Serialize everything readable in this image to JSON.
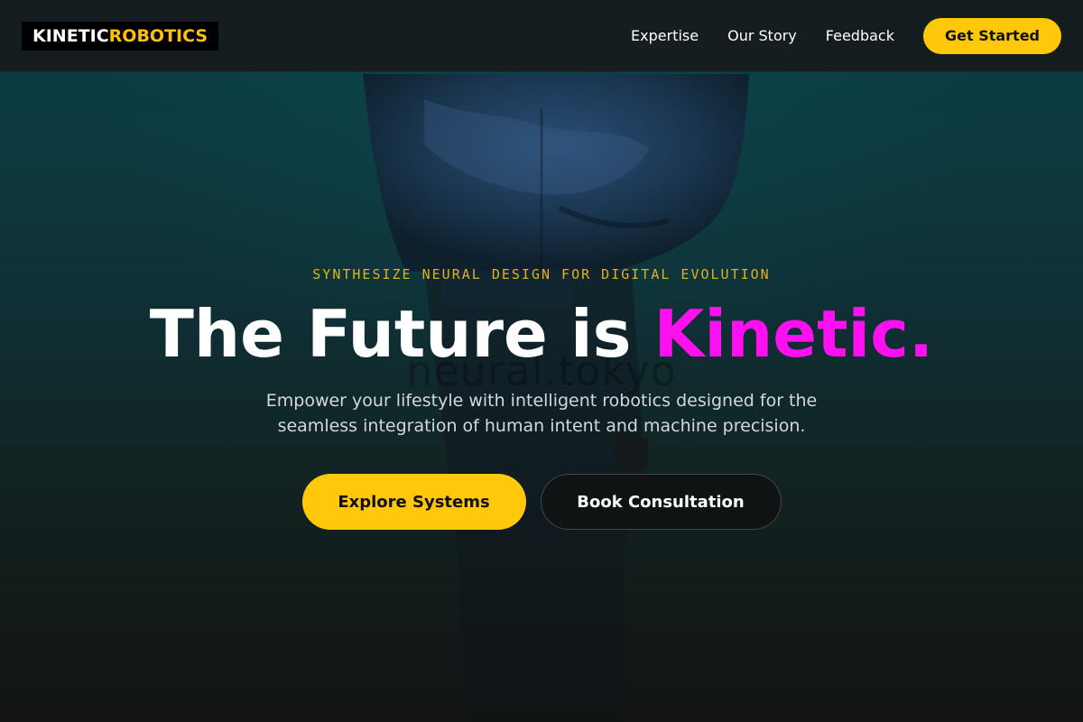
{
  "header": {
    "logo": {
      "part1": "KINETIC",
      "part2": "ROBOTICS"
    },
    "nav": [
      {
        "label": "Expertise"
      },
      {
        "label": "Our Story"
      },
      {
        "label": "Feedback"
      }
    ],
    "cta_label": "Get Started"
  },
  "hero": {
    "eyebrow": "SYNTHESIZE NEURAL DESIGN FOR DIGITAL EVOLUTION",
    "headline_main": "The Future is ",
    "headline_accent": "Kinetic.",
    "subtext": "Empower your lifestyle with intelligent robotics designed for the seamless integration of human intent and machine precision.",
    "watermark": "neural.tokyo",
    "primary_cta": "Explore Systems",
    "secondary_cta": "Book Consultation"
  },
  "colors": {
    "accent_yellow": "#ffc80a",
    "accent_magenta": "#ff10f0",
    "header_bg": "#161b1d",
    "hero_teal": "#0b3f46"
  },
  "icons": {
    "hero_image": "robot-fist-image"
  }
}
